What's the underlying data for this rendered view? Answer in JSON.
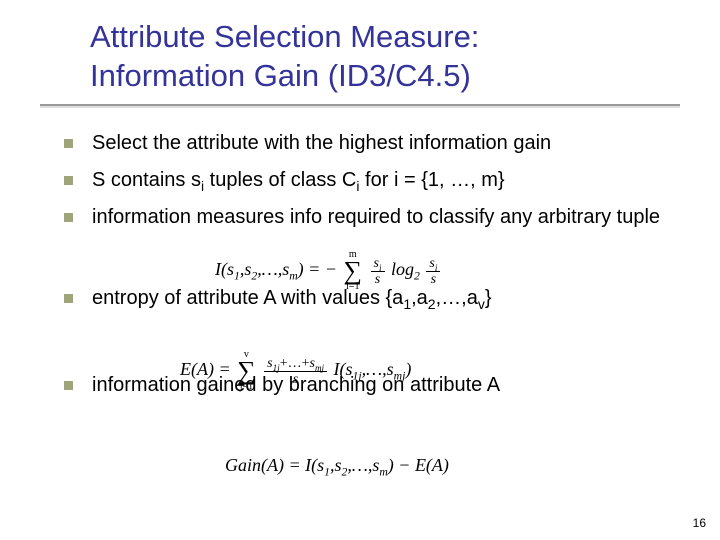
{
  "title_line1": "Attribute Selection Measure:",
  "title_line2": "Information Gain (ID3/C4.5)",
  "bullets": {
    "b1": "Select the attribute with the highest information gain",
    "b2_pre": "S contains s",
    "b2_mid": " tuples of class C",
    "b2_post": " for i = {1, …, m}",
    "b3": "information measures info required to classify any arbitrary tuple",
    "b4_pre": "entropy of attribute A with values {a",
    "b4_mid1": ",a",
    "b4_mid2": ",…,a",
    "b4_post": "}",
    "b5": "information gained by branching on attribute A"
  },
  "formulas": {
    "f1_lhs": "I(s",
    "f1_args": ",s",
    "f1_args2": ",…,s",
    "f1_rhs1": ") = −",
    "f1_sum_top": "m",
    "f1_sum_bot": "i=1",
    "f1_frac_num": "s",
    "f1_frac_den": "s",
    "f1_log": "log",
    "f2_lhs": "E(A) = ",
    "f2_sum_top": "v",
    "f2_sum_bot": "j=1",
    "f2_num_a": "s",
    "f2_num_plus": "+…+",
    "f2_num_b": "s",
    "f2_den": "s",
    "f2_I": " I(s",
    "f2_I_mid": ",…,s",
    "f2_I_end": ")",
    "f3": "Gain(A) = I(s",
    "f3_mid": ",s",
    "f3_mid2": ",…,s",
    "f3_end": ") − E(A)"
  },
  "subscripts": {
    "i": "i",
    "one": "1",
    "two": "2",
    "m": "m",
    "v": "v",
    "onej": "1j",
    "mj": "mj"
  },
  "page_number": "16"
}
